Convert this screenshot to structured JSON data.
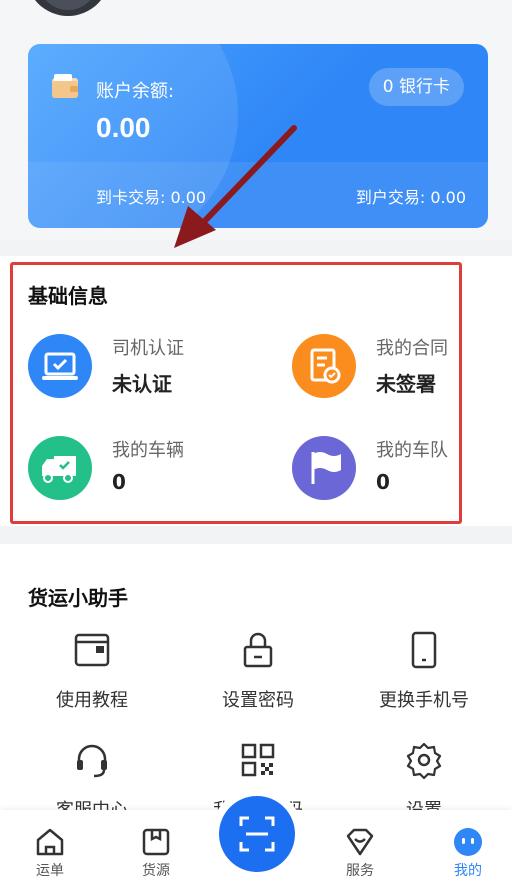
{
  "account": {
    "balance_label": "账户余额:",
    "balance_value": "0.00",
    "bank_card_label": "0 银行卡",
    "card_trade_label": "到卡交易: 0.00",
    "account_trade_label": "到户交易: 0.00"
  },
  "basic_info": {
    "title": "基础信息",
    "items": [
      {
        "label": "司机认证",
        "value": "未认证",
        "icon": "driver-certification-icon",
        "color": "#2f86f6"
      },
      {
        "label": "我的合同",
        "value": "未签署",
        "icon": "contract-icon",
        "color": "#fb8c1e"
      },
      {
        "label": "我的车辆",
        "value": "0",
        "icon": "truck-icon",
        "color": "#23c08a"
      },
      {
        "label": "我的车队",
        "value": "0",
        "icon": "flag-icon",
        "color": "#6b67d6"
      }
    ]
  },
  "helper": {
    "title": "货运小助手",
    "items": [
      {
        "label": "使用教程",
        "icon": "tutorial-book-icon"
      },
      {
        "label": "设置密码",
        "icon": "lock-icon"
      },
      {
        "label": "更换手机号",
        "icon": "phone-icon"
      },
      {
        "label": "客服中心",
        "icon": "headset-icon"
      },
      {
        "label": "我的二维码",
        "icon": "qr-code-icon"
      },
      {
        "label": "设置",
        "icon": "gear-icon"
      }
    ]
  },
  "tabs": [
    {
      "label": "运单",
      "icon": "home-icon"
    },
    {
      "label": "货源",
      "icon": "package-icon"
    },
    {
      "label": "服务",
      "icon": "service-bag-icon"
    },
    {
      "label": "我的",
      "icon": "profile-face-icon",
      "active": true
    }
  ],
  "colors": {
    "accent": "#2f86f6",
    "highlight_box": "#e03c3c",
    "annotation_arrow": "#8b1a1f"
  }
}
